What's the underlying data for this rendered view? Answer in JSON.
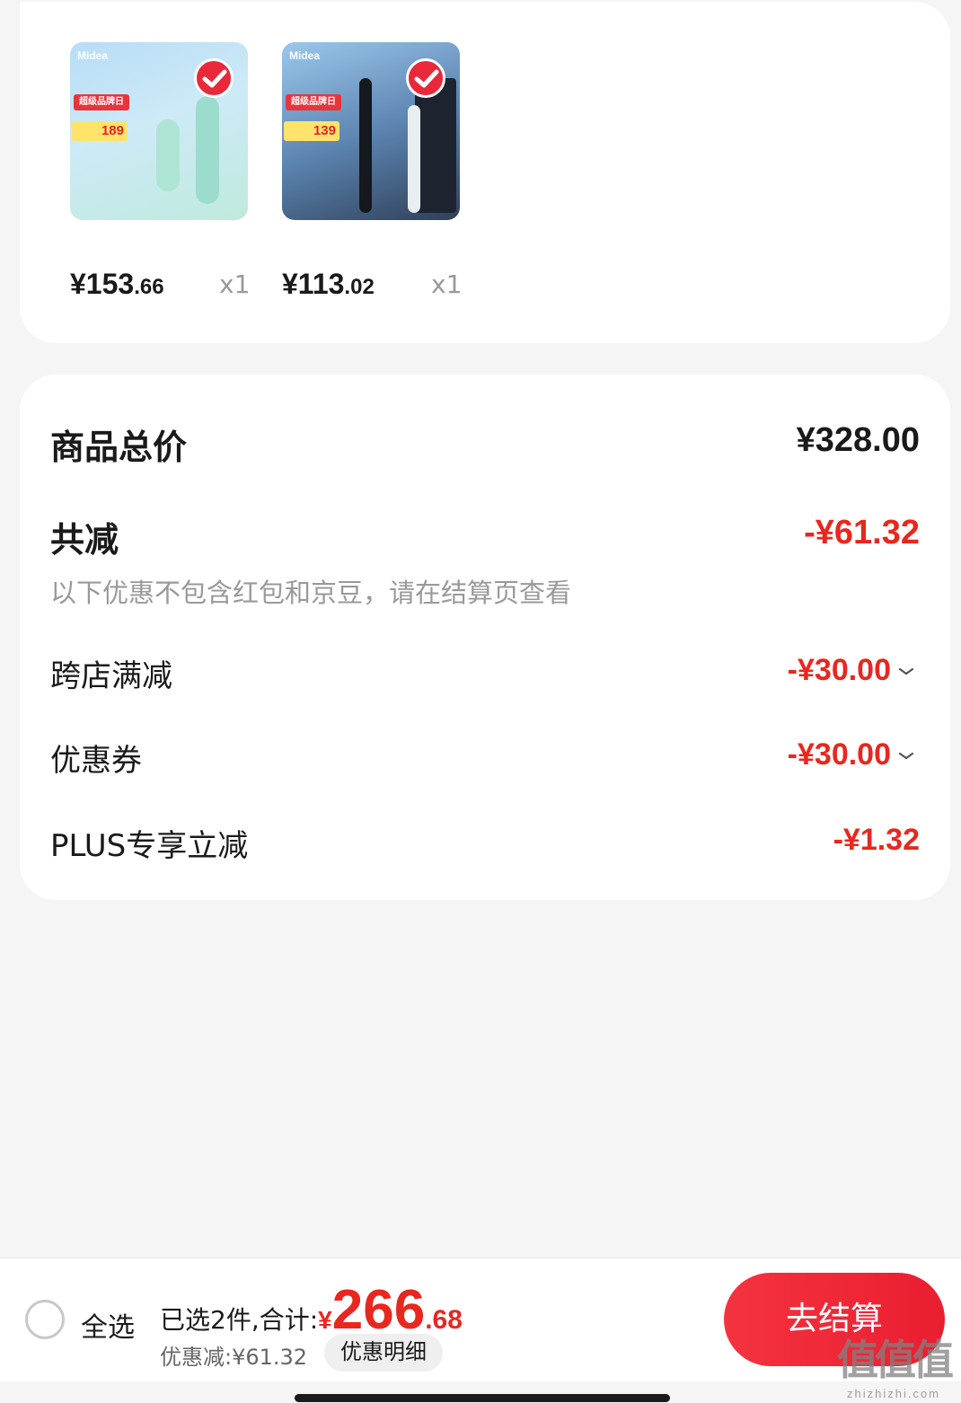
{
  "products": [
    {
      "image_brand": "Midea",
      "image_promo": "超级品牌日",
      "image_price": "189",
      "price_main": "¥153",
      "price_cents": ".66",
      "quantity": "x1",
      "selected": true
    },
    {
      "image_brand": "Midea",
      "image_promo": "超级品牌日",
      "image_price": "139",
      "price_main": "¥113",
      "price_cents": ".02",
      "quantity": "x1",
      "selected": true
    }
  ],
  "summary": {
    "total_label": "商品总价",
    "total_value": "¥328.00",
    "reduction_label": "共减",
    "reduction_value": "-¥61.32",
    "note": "以下优惠不包含红包和京豆，请在结算页查看",
    "items": [
      {
        "label": "跨店满减",
        "value": "-¥30.00",
        "expandable": true
      },
      {
        "label": "优惠券",
        "value": "-¥30.00",
        "expandable": true
      },
      {
        "label": "PLUS专享立减",
        "value": "-¥1.32",
        "expandable": false
      }
    ]
  },
  "bottom_bar": {
    "select_all_label": "全选",
    "selected_prefix": "已选2件,合计:",
    "total_symbol": "¥",
    "total_int": "266",
    "total_dec": ".68",
    "saved_text": "优惠减:¥61.32",
    "detail_button": "优惠明细",
    "checkout_button": "去结算"
  },
  "watermark": {
    "main": "值值值",
    "sub": "zhizhizhi.com"
  },
  "colors": {
    "accent_red": "#e8271f",
    "checkout_red": "#f5333f",
    "background": "#f5f5f5"
  }
}
